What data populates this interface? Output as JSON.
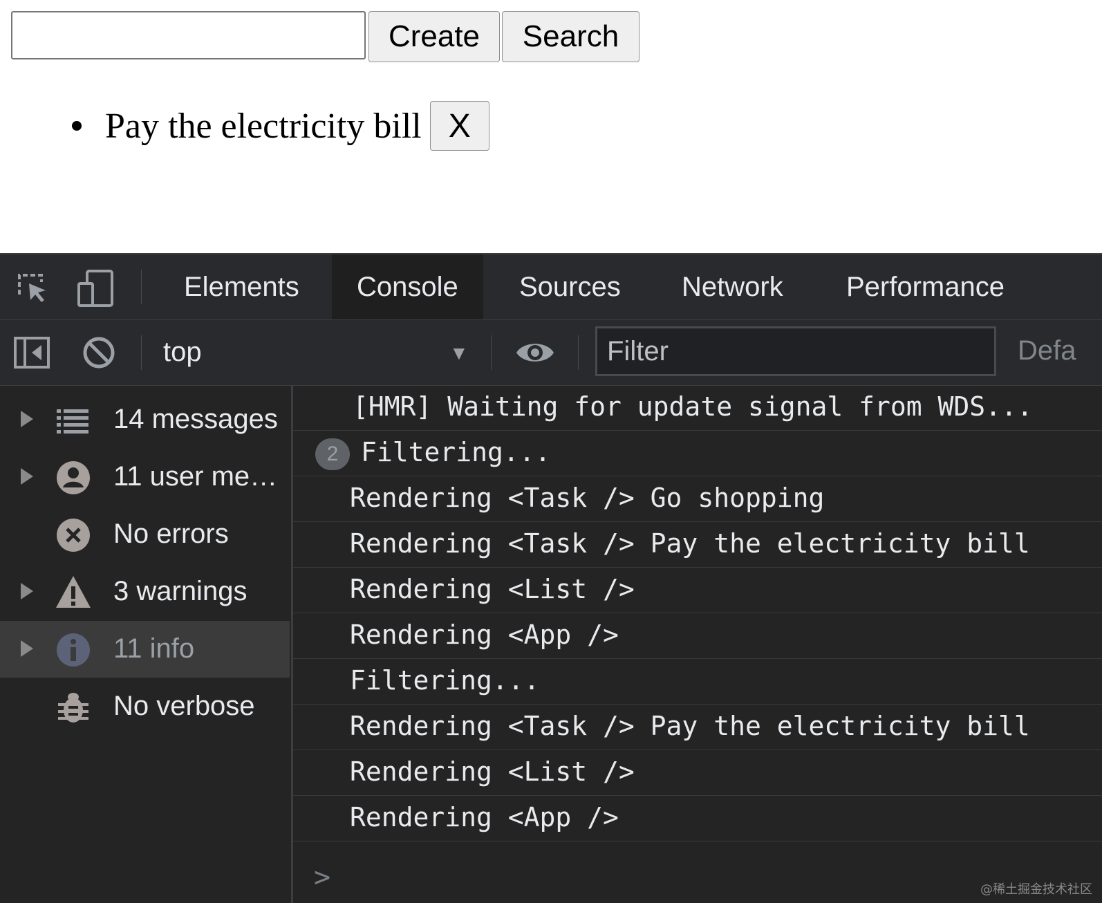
{
  "page": {
    "input_value": "",
    "create_label": "Create",
    "search_label": "Search",
    "tasks": [
      {
        "text": "Pay the electricity bill",
        "remove_label": "X"
      }
    ]
  },
  "devtools": {
    "tabs": [
      "Elements",
      "Console",
      "Sources",
      "Network",
      "Performance"
    ],
    "active_tab": "Console",
    "toolbar": {
      "context": "top",
      "filter_placeholder": "Filter",
      "levels_label": "Defa"
    },
    "sidebar": [
      {
        "label": "14 messages",
        "icon": "list-icon",
        "expandable": true
      },
      {
        "label": "11 user me…",
        "icon": "user-icon",
        "expandable": true
      },
      {
        "label": "No errors",
        "icon": "error-icon",
        "expandable": false
      },
      {
        "label": "3 warnings",
        "icon": "warning-icon",
        "expandable": true
      },
      {
        "label": "11 info",
        "icon": "info-icon",
        "expandable": true,
        "selected": true
      },
      {
        "label": "No verbose",
        "icon": "bug-icon",
        "expandable": false
      }
    ],
    "messages": [
      {
        "text": "[HMR] Waiting for update signal from WDS..."
      },
      {
        "text": "Filtering...",
        "repeat": "2"
      },
      {
        "text": "Rendering <Task /> Go shopping"
      },
      {
        "text": "Rendering <Task /> Pay the electricity bill"
      },
      {
        "text": "Rendering <List />"
      },
      {
        "text": "Rendering <App />"
      },
      {
        "text": "Filtering..."
      },
      {
        "text": "Rendering <Task /> Pay the electricity bill"
      },
      {
        "text": "Rendering <List />"
      },
      {
        "text": "Rendering <App />"
      }
    ],
    "prompt_symbol": ">"
  },
  "watermark": "@稀土掘金技术社区",
  "colors": {
    "devtools_bg": "#242424",
    "toolbar_bg": "#292a2d",
    "text": "#e8eaed",
    "selected_row": "#3b3b3b"
  }
}
